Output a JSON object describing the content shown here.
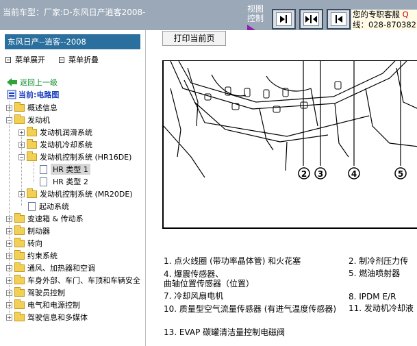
{
  "topbar": {
    "car_label": "当前车型：厂家:D-东风日产逍客2008-",
    "view_control_label": "视图控制",
    "service_line1": "您的专职客服",
    "service_q": "Q",
    "service_line2": "线：028-870382"
  },
  "sidebar": {
    "header": "东风日产--逍客--2008",
    "expand_all": "菜单展开",
    "collapse_all": "菜单折叠",
    "back": "返回上一级",
    "current": "当前:电路图"
  },
  "tree": [
    {
      "label": "概述信息",
      "pm": "+"
    },
    {
      "label": "发动机",
      "pm": "−"
    },
    {
      "label": "发动机润滑系统",
      "pm": "+"
    },
    {
      "label": "发动机冷却系统",
      "pm": "+"
    },
    {
      "label": "发动机控制系统 (HR16DE)",
      "pm": "−"
    },
    {
      "label": "HR 类型 1"
    },
    {
      "label": "HR 类型 2"
    },
    {
      "label": "发动机控制系统 (MR20DE)",
      "pm": "+"
    },
    {
      "label": "起动系统"
    },
    {
      "label": "变速箱 & 传动系",
      "pm": "+"
    },
    {
      "label": "制动器",
      "pm": "+"
    },
    {
      "label": "转向",
      "pm": "+"
    },
    {
      "label": "约束系统",
      "pm": "+"
    },
    {
      "label": "通风、加热器和空调",
      "pm": "+"
    },
    {
      "label": "车身外部、车门、车顶和车辆安全",
      "pm": "+"
    },
    {
      "label": "驾驶员控制",
      "pm": "+"
    },
    {
      "label": "电气和电源控制",
      "pm": "+"
    },
    {
      "label": "驾驶信息和多媒体",
      "pm": "+"
    }
  ],
  "content": {
    "print_button": "打印当前页",
    "callouts": [
      "2",
      "3",
      "4",
      "5"
    ],
    "legend": [
      "1.  点火线圈 (带功率晶体管) 和火花塞",
      "2.  制冷剂压力传",
      "4.  爆震传感器、",
      "     曲轴位置传感器（位置）",
      "5.  燃油喷射器",
      "7.  冷却风扇电机",
      "8.  IPDM E/R",
      "10. 质量型空气流量传感器 (有进气温度传感器)",
      "11. 发动机冷却液",
      "13. EVAP 碳罐清洁量控制电磁阀"
    ]
  }
}
